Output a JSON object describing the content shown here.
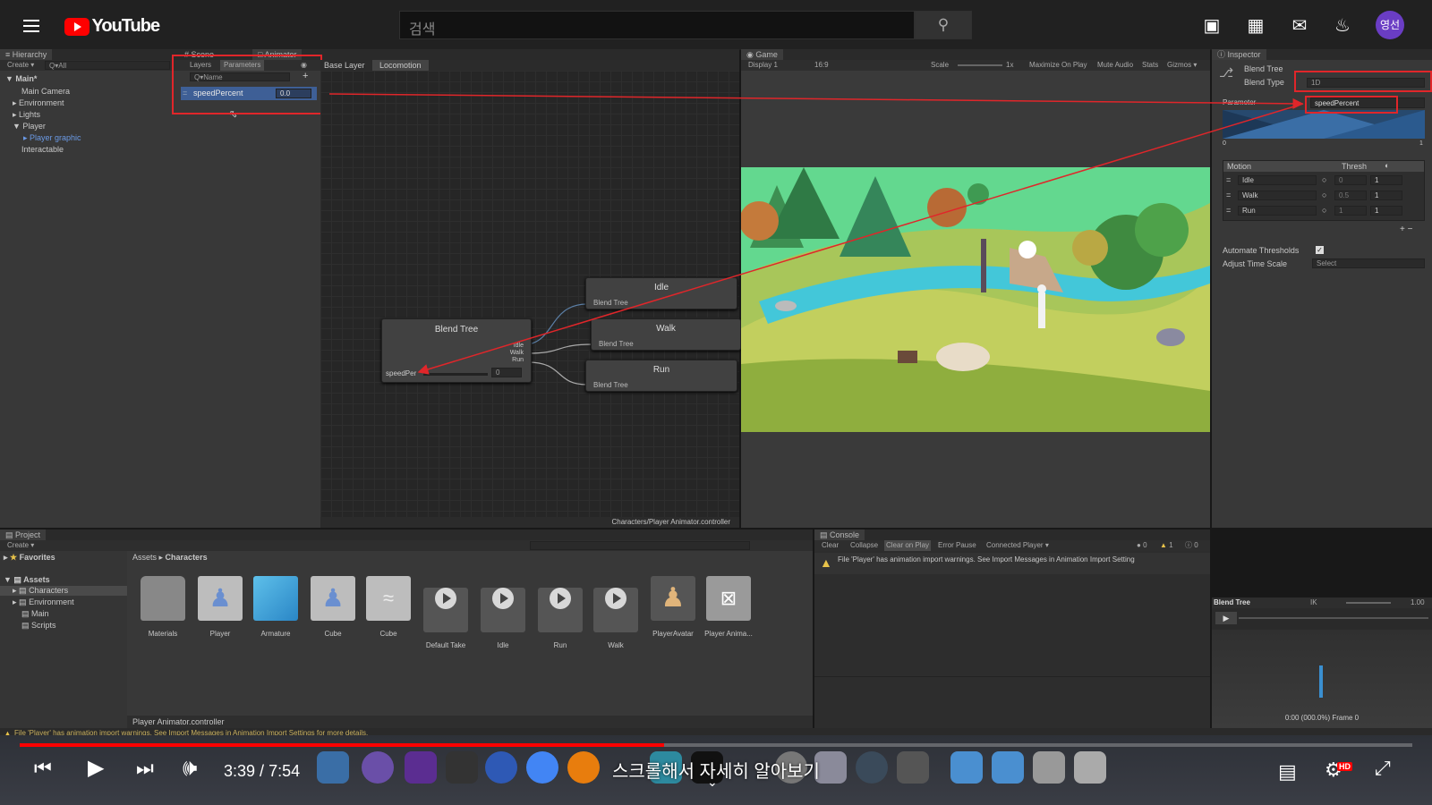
{
  "youtube": {
    "brand": "YouTube",
    "search_placeholder": "검색",
    "avatar_text": "영선",
    "icons": [
      "menu-icon",
      "search-icon",
      "create-video-icon",
      "apps-grid-icon",
      "messages-icon",
      "notifications-bell-icon"
    ]
  },
  "hierarchy": {
    "tab": "Hierarchy",
    "create": "Create ▾",
    "search_placeholder": "Q▾All",
    "scene": "Main*",
    "items": [
      "Main Camera",
      "Environment",
      "Lights",
      "Player",
      "Player graphic",
      "Interactable"
    ]
  },
  "animator": {
    "tabs": [
      "Scene",
      "Animator"
    ],
    "subtabs": [
      "Layers",
      "Parameters"
    ],
    "param_search_placeholder": "Q▾Name",
    "parameter": {
      "name": "speedPercent",
      "value": "0.0"
    },
    "breadcrumbs": [
      "Base Layer",
      "Locomotion"
    ],
    "blend_tree_node": {
      "title": "Blend Tree",
      "outputs": [
        "Idle",
        "Walk",
        "Run"
      ],
      "param_label": "speedPer",
      "param_value": "0"
    },
    "motion_nodes": [
      {
        "title": "Idle",
        "sub": "Blend Tree"
      },
      {
        "title": "Walk",
        "sub": "Blend Tree"
      },
      {
        "title": "Run",
        "sub": "Blend Tree"
      }
    ],
    "footer_path": "Characters/Player Animator.controller"
  },
  "game": {
    "tab": "Game",
    "display": "Display 1",
    "aspect": "16:9",
    "scale_label": "Scale",
    "scale_value": "1x",
    "toolbar_items": [
      "Maximize On Play",
      "Mute Audio",
      "Stats",
      "Gizmos ▾"
    ]
  },
  "inspector": {
    "tab": "Inspector",
    "object": "Blend Tree",
    "blend_type_label": "Blend Type",
    "blend_type_value": "1D",
    "parameter_label": "Parameter",
    "parameter_value": "speedPercent",
    "graph_min": "0",
    "graph_max": "1",
    "motion_header": "Motion",
    "thresh_header": "Thresh",
    "motions": [
      {
        "name": "Idle",
        "thresh": "0",
        "speed": "1"
      },
      {
        "name": "Walk",
        "thresh": "0.5",
        "speed": "1"
      },
      {
        "name": "Run",
        "thresh": "1",
        "speed": "1"
      }
    ],
    "automate_label": "Automate Thresholds",
    "automate_checked": "✓",
    "adjust_label": "Adjust Time Scale",
    "adjust_value": "Select",
    "preview_title": "Blend Tree",
    "preview_ik": "IK",
    "preview_speed": "1.00",
    "preview_time": "0:00 (000.0%) Frame 0"
  },
  "project": {
    "tab": "Project",
    "create": "Create ▾",
    "favorites": "Favorites",
    "assets_root": "Assets",
    "folders": [
      "Characters",
      "Environment",
      "Main",
      "Scripts"
    ],
    "breadcrumb": [
      "Assets",
      "Characters"
    ],
    "assets": [
      "Materials",
      "Player",
      "Armature",
      "Cube",
      "Cube",
      "Default Take",
      "Idle",
      "Run",
      "Walk",
      "PlayerAvatar",
      "Player Anima..."
    ],
    "footer": "Player Animator.controller"
  },
  "console": {
    "tab": "Console",
    "buttons": [
      "Clear",
      "Collapse",
      "Clear on Play",
      "Error Pause",
      "Connected Player ▾"
    ],
    "counts": [
      "0",
      "1",
      "0"
    ],
    "message": "File 'Player' has animation import warnings. See Import Messages in Animation Import Setting"
  },
  "status_bar": "File 'Player' has animation import warnings. See Import Messages in Animation Import Settings for more details.",
  "player": {
    "time_current": "3:39",
    "time_total": "7:54",
    "time_sep": " / ",
    "progress_fraction": 0.463,
    "caption": "스크롤해서 자세히 알아보기",
    "badge": "HD"
  },
  "colors": {
    "highlight_red": "#e0262a",
    "unity_selection": "#3e5f96",
    "youtube_red": "#ff0000"
  }
}
